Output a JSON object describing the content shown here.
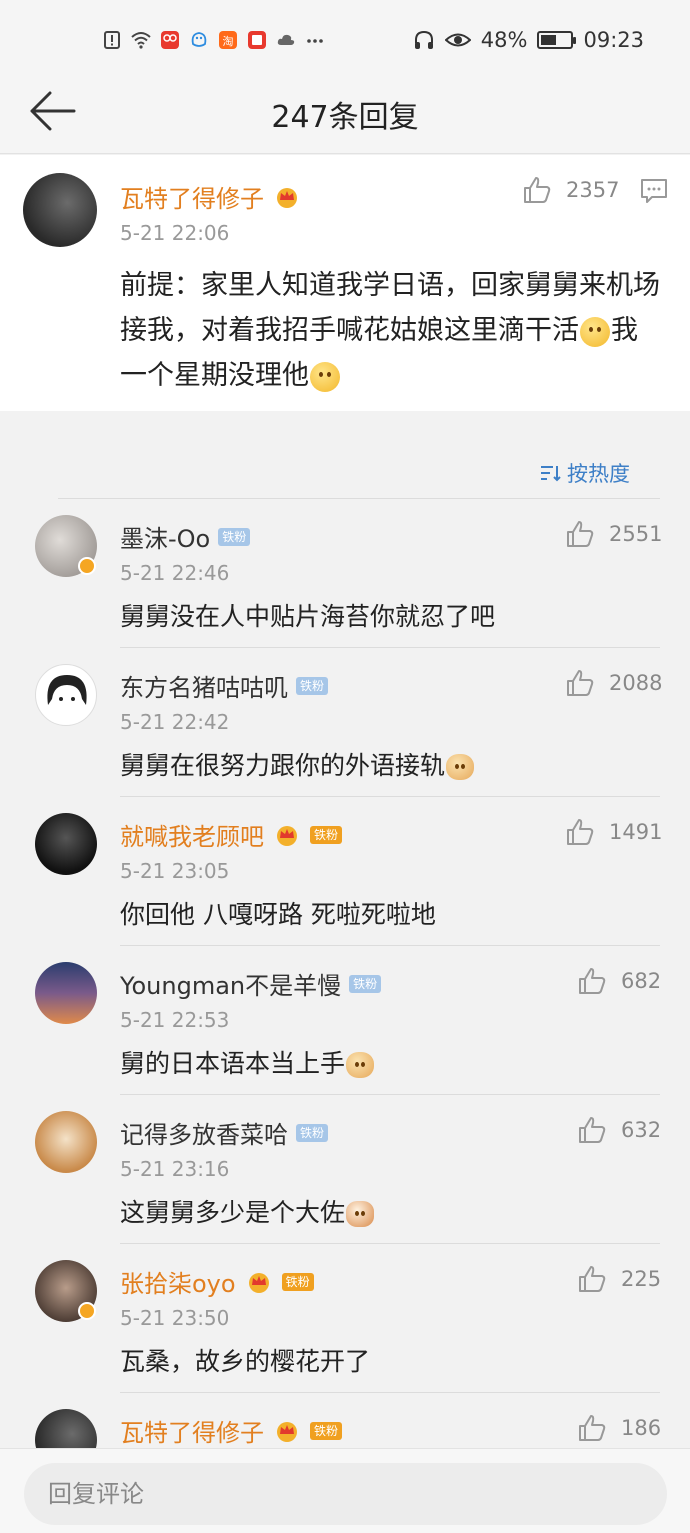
{
  "status_bar": {
    "icons": [
      "notification-icon",
      "wifi-icon",
      "app-icon-1",
      "app-icon-2",
      "taobao-icon",
      "app-icon-3",
      "cloud-icon",
      "more-dots-icon"
    ],
    "battery": "48%",
    "time": "09:23"
  },
  "header": {
    "title": "247条回复"
  },
  "main_comment": {
    "username": "瓦特了得修子",
    "time": "5-21 22:06",
    "likes": "2357",
    "text_parts": [
      "前提：家里人知道我学日语，回家舅舅来机场接我，对着我招手喊花姑娘这里滴干活",
      "我一个星期没理他"
    ]
  },
  "sort": {
    "label": "按热度"
  },
  "replies": [
    {
      "username": "墨沫-Oo",
      "badge": "铁粉",
      "time": "5-21 22:46",
      "likes": "2551",
      "text": "舅舅没在人中贴片海苔你就忍了吧"
    },
    {
      "username": "东方名猪咕咕叽",
      "badge": "铁粉",
      "time": "5-21 22:42",
      "likes": "2088",
      "text": "舅舅在很努力跟你的外语接轨"
    },
    {
      "username": "就喊我老顾吧",
      "badge": "铁粉",
      "time": "5-21 23:05",
      "likes": "1491",
      "text": "你回他 八嘎呀路 死啦死啦地"
    },
    {
      "username": "Youngman不是羊慢",
      "badge": "铁粉",
      "time": "5-21 22:53",
      "likes": "682",
      "text": "舅的日本语本当上手"
    },
    {
      "username": "记得多放香菜哈",
      "badge": "铁粉",
      "time": "5-21 23:16",
      "likes": "632",
      "text": "这舅舅多少是个大佐"
    },
    {
      "username": "张拾柒oyo",
      "badge": "铁粉",
      "time": "5-21 23:50",
      "likes": "225",
      "text": "瓦桑，故乡的樱花开了"
    },
    {
      "username": "瓦特了得修子",
      "badge": "铁粉",
      "time": "",
      "likes": "186",
      "text": ""
    }
  ],
  "bottom_bar": {
    "placeholder": "回复评论"
  }
}
